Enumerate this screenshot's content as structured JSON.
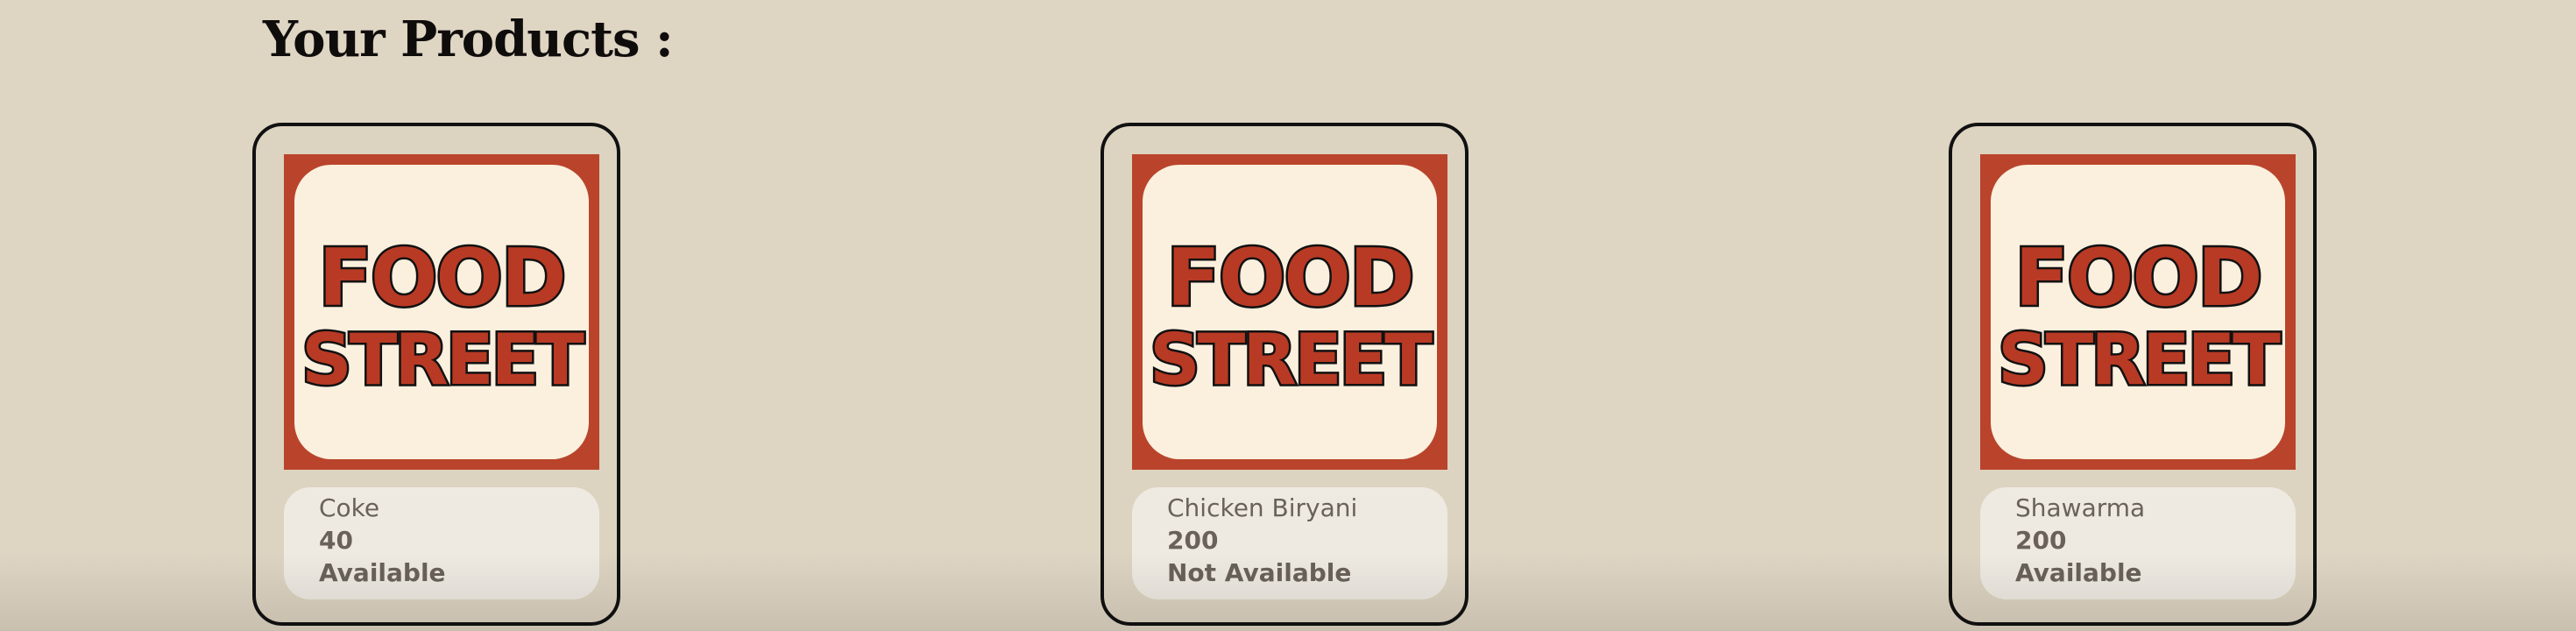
{
  "page": {
    "title": "Your Products :"
  },
  "brand": {
    "logo_text": [
      "FOOD",
      "STREET"
    ],
    "colors": {
      "logo_bg": "#b9442b",
      "logo_panel": "#fbf0de",
      "logo_letters": "#b83a24"
    }
  },
  "products": [
    {
      "name": "Coke",
      "price": "40",
      "availability": "Available"
    },
    {
      "name": "Chicken Biryani",
      "price": "200",
      "availability": "Not Available"
    },
    {
      "name": "Shawarma",
      "price": "200",
      "availability": "Available"
    }
  ]
}
